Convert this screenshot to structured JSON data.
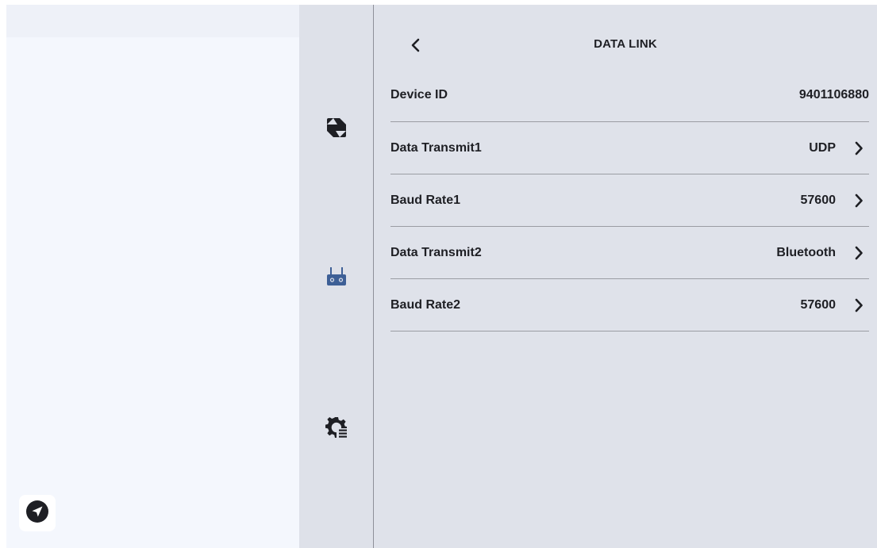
{
  "header": {
    "title": "DATA LINK",
    "back_icon": "chevron-left-icon"
  },
  "rail": {
    "items": [
      {
        "icon": "camera-shutter-icon",
        "selected": false
      },
      {
        "icon": "remote-controller-icon",
        "selected": true
      },
      {
        "icon": "settings-gear-icon",
        "selected": false
      }
    ]
  },
  "left": {
    "nav_icon": "navigation-arrow-icon"
  },
  "rows": [
    {
      "label": "Device ID",
      "value": "9401106880"
    },
    {
      "label": "Data Transmit1",
      "value": "UDP"
    },
    {
      "label": "Baud Rate1",
      "value": "57600"
    },
    {
      "label": "Data Transmit2",
      "value": "Bluetooth"
    },
    {
      "label": "Baud Rate2",
      "value": "57600"
    }
  ],
  "colors": {
    "accent": "#3d5f96",
    "text": "#1e1f24",
    "panel_bg": "#dfe2ea",
    "rail_bg": "#dee1e9",
    "left_bg": "#f4f7fd"
  }
}
